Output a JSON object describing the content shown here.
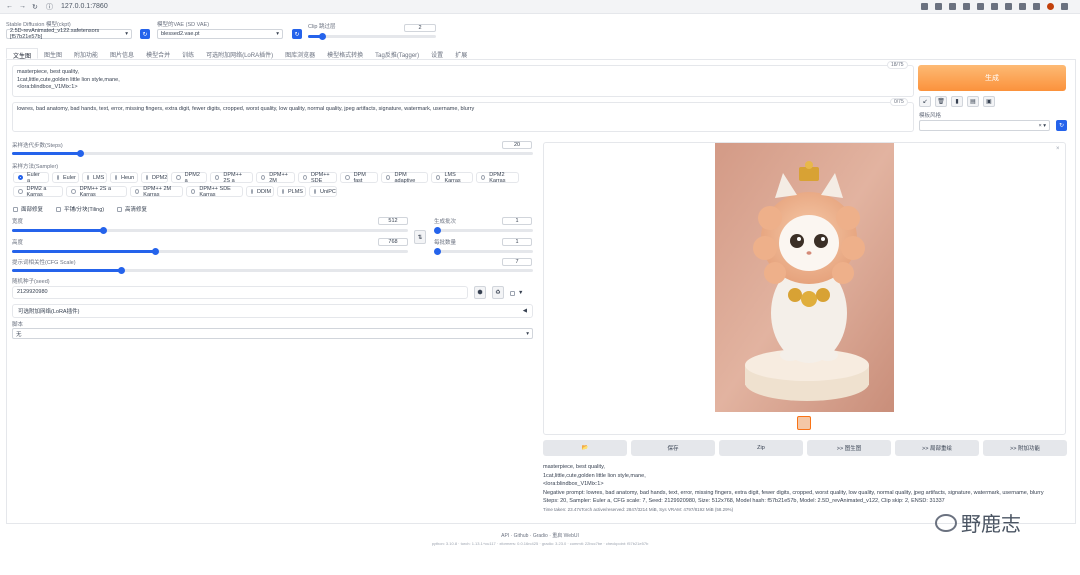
{
  "browser": {
    "url": "127.0.0.1:7860"
  },
  "top": {
    "model_label": "Stable Diffusion 模型(ckpt)",
    "model_value": "2.5D-revAnimated_v122.safetensors [f57b21e57b]",
    "vae_label": "模型的VAE (SD VAE)",
    "vae_value": "blessed2.vae.pt",
    "clip_label": "Clip 跳过层",
    "clip_value": "2"
  },
  "tabs": [
    "文生图",
    "图生图",
    "附加功能",
    "图片信息",
    "模型合并",
    "训练",
    "可选附加网络(LoRA插件)",
    "图库浏览器",
    "模型格式转换",
    "Tag反推(Tagger)",
    "设置",
    "扩展"
  ],
  "prompt": {
    "positive_lines": [
      "masterpiece, best quality,",
      "1cat,little,cute,golden little lion style,mane,",
      "<lora:blindbox_V1Mix:1>"
    ],
    "positive_count": "18/75",
    "negative": "lowres, bad anatomy, bad hands, text, error, missing fingers, extra digit, fewer digits, cropped, worst quality, low quality, normal quality, jpeg artifacts, signature, watermark, username, blurry",
    "negative_count": "0/75"
  },
  "generate_label": "生成",
  "style_label": "模板风格",
  "steps": {
    "label": "采样迭代步数(Steps)",
    "value": "20",
    "fraction": 0.13
  },
  "sampler": {
    "label": "采样方法(Sampler)",
    "options": [
      "Euler a",
      "Euler",
      "LMS",
      "Heun",
      "DPM2",
      "DPM2 a",
      "DPM++ 2S a",
      "DPM++ 2M",
      "DPM++ SDE",
      "DPM fast",
      "DPM adaptive",
      "LMS Karras",
      "DPM2 Karras",
      "DPM2 a Karras",
      "DPM++ 2S a Karras",
      "DPM++ 2M Karras",
      "DPM++ SDE Karras",
      "DDIM",
      "PLMS",
      "UniPC"
    ],
    "selected": "Euler a"
  },
  "checks": [
    "面部修复",
    "平铺/分块(Tiling)",
    "高清修复"
  ],
  "width": {
    "label": "宽度",
    "value": "512",
    "fraction": 0.23
  },
  "height": {
    "label": "高度",
    "value": "768",
    "fraction": 0.36
  },
  "batch_count": {
    "label": "生成批次",
    "value": "1",
    "fraction": 0.0
  },
  "batch_size": {
    "label": "每批数量",
    "value": "1",
    "fraction": 0.0
  },
  "swap_icon": "swap-icon",
  "cfg": {
    "label": "提示词相关性(CFG Scale)",
    "value": "7",
    "fraction": 0.21
  },
  "seed": {
    "label": "随机种子(seed)",
    "value": "2129920980"
  },
  "accordion_label": "可选附加网络(LoRA插件)",
  "script": {
    "label": "脚本",
    "value": "无"
  },
  "actions": [
    "📂",
    "保存",
    "Zip",
    ">> 图生图",
    ">> 局部重绘",
    ">> 附加功能"
  ],
  "info": {
    "lines": [
      "masterpiece, best quality,",
      "1cat,little,cute,golden little lion style,mane,",
      "<lora:blindbox_V1Mix:1>"
    ],
    "negative": "Negative prompt: lowres, bad anatomy, bad hands, text, error, missing fingers, extra digit, fewer digits, cropped, worst quality, low quality, normal quality, jpeg artifacts, signature, watermark, username, blurry",
    "params": "Steps: 20, Sampler: Euler a, CFG scale: 7, Seed: 2129920980, Size: 512x768, Model hash: f57b21e57b, Model: 2.5D_revAnimated_v122, Clip skip: 2, ENSD: 31337",
    "timing": "Time taken: 23.47sTorch active/reserved: 2847/3214 MiB, Sys VRAM: 4797/8192 MiB (58.29%)"
  },
  "footer": {
    "links": "API · Github · Gradio · 重启 WebUI",
    "versions": "python: 3.10.8  ·  torch: 1.13.1+cu117  ·  xformers: 0.0.16rc425  ·  gradio: 3.23.0  ·  commit: 22bcc7be  ·  checkpoint: f57b21e57b"
  },
  "watermark": "野鹿志"
}
